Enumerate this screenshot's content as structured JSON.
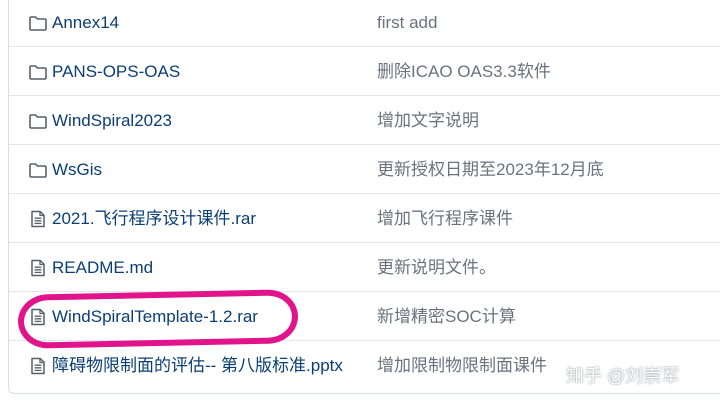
{
  "files": [
    {
      "name": "Annex14",
      "type": "folder",
      "message": "first add"
    },
    {
      "name": "PANS-OPS-OAS",
      "type": "folder",
      "message": "删除ICAO OAS3.3软件"
    },
    {
      "name": "WindSpiral2023",
      "type": "folder",
      "message": "增加文字说明"
    },
    {
      "name": "WsGis",
      "type": "folder",
      "message": "更新授权日期至2023年12月底"
    },
    {
      "name": "2021.飞行程序设计课件.rar",
      "type": "file",
      "message": "增加飞行程序课件"
    },
    {
      "name": "README.md",
      "type": "file",
      "message": "更新说明文件。"
    },
    {
      "name": "WindSpiralTemplate-1.2.rar",
      "type": "file",
      "message": "新增精密SOC计算"
    },
    {
      "name": "障碍物限制面的评估-- 第八版标准.pptx",
      "type": "file",
      "message": "增加限制物限制面课件"
    }
  ],
  "icons": {
    "folder": "folder-icon",
    "file": "file-icon"
  },
  "highlight_color": "#e2148c",
  "watermark": "知乎 @刘崇军"
}
